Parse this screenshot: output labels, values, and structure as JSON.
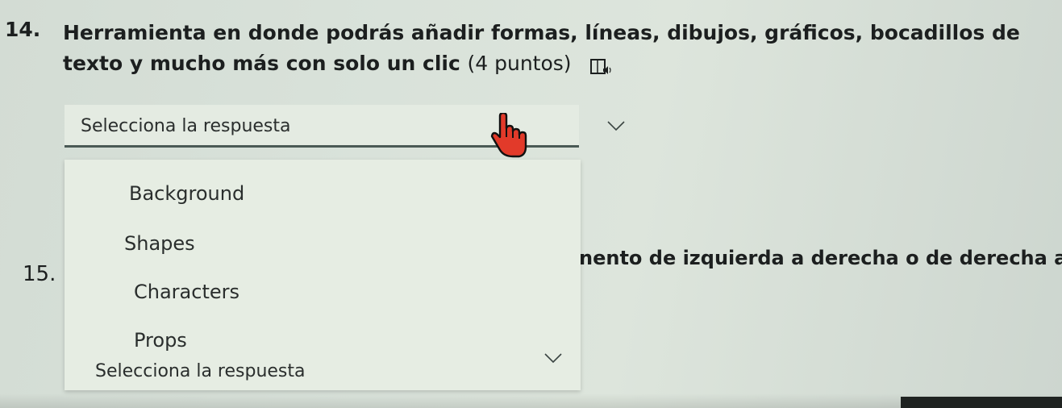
{
  "question14": {
    "number": "14.",
    "text": "Herramienta en donde podrás añadir formas, líneas, dibujos, gráficos, bocadillos de texto y mucho más con solo un clic",
    "points": "(4 puntos)",
    "reader_icon": "immersive-reader-icon"
  },
  "answer_select": {
    "placeholder": "Selecciona la respuesta"
  },
  "dropdown": {
    "options": [
      "Background",
      "Shapes",
      "Characters",
      "Props"
    ],
    "next_placeholder": "Selecciona la respuesta"
  },
  "question15": {
    "number": "15.",
    "visible_text": "nento de izquierda a derecha o de derecha a"
  },
  "colors": {
    "background": "#d9e2da",
    "select_underline": "#4a5a55",
    "cursor_red": "#e23a2a"
  }
}
